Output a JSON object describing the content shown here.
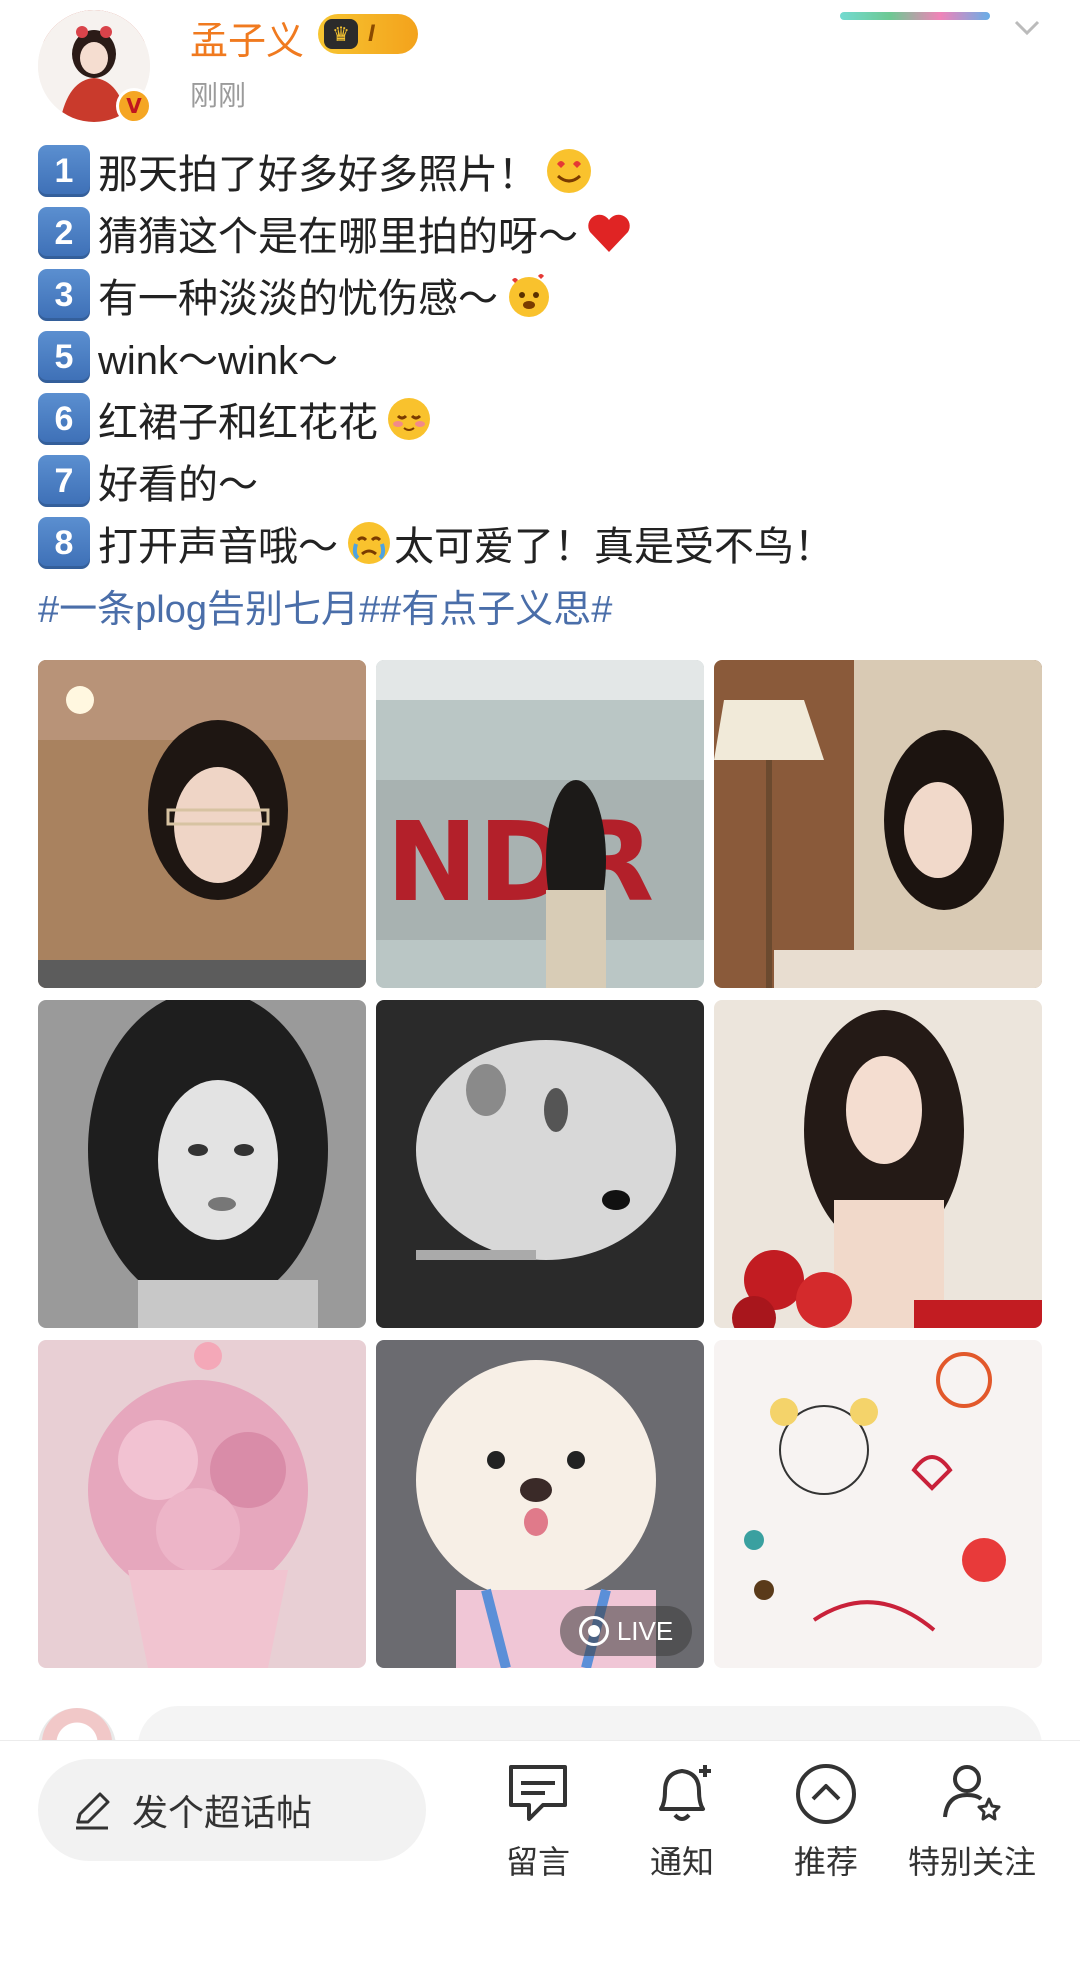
{
  "post": {
    "username": "孟子义",
    "vip_level": "I",
    "timestamp": "刚刚",
    "lines": [
      {
        "key": "1",
        "text": "那天拍了好多好多照片！",
        "emoji": "smiling-face-with-hearts"
      },
      {
        "key": "2",
        "text": "猜猜这个是在哪里拍的呀～",
        "emoji": "red-heart"
      },
      {
        "key": "3",
        "text": "有一种淡淡的忧伤感～",
        "emoji": "smiling-face-with-hearts"
      },
      {
        "key": "5",
        "text": "wink～wink～",
        "emoji": ""
      },
      {
        "key": "6",
        "text": "红裙子和红花花",
        "emoji": "blushing-face"
      },
      {
        "key": "7",
        "text": "好看的～",
        "emoji": ""
      },
      {
        "key": "8",
        "text": "打开声音哦～",
        "emoji": "crying-face",
        "tail": "太可爱了！真是受不鸟！"
      }
    ],
    "hashtags": "#一条plog告别七月##有点子义思#",
    "photos": [
      {
        "name": "photo-glasses-portrait"
      },
      {
        "name": "photo-red-letters-wall"
      },
      {
        "name": "photo-lamp-portrait"
      },
      {
        "name": "photo-bw-portrait"
      },
      {
        "name": "photo-bw-closeup"
      },
      {
        "name": "photo-roses-portrait"
      },
      {
        "name": "photo-pink-hydrangea"
      },
      {
        "name": "photo-white-puppy",
        "badge": "LIVE"
      },
      {
        "name": "photo-child-drawing"
      }
    ]
  },
  "bottom_bar": {
    "compose_label": "发个超话帖",
    "nav": [
      {
        "label": "留言",
        "icon": "message-icon"
      },
      {
        "label": "通知",
        "icon": "bell-icon"
      },
      {
        "label": "推荐",
        "icon": "chevron-up-circle-icon"
      },
      {
        "label": "特别关注",
        "icon": "user-star-icon"
      }
    ]
  },
  "colors": {
    "username": "#f07a1f",
    "hashtag": "#4a6ea9",
    "timestamp": "#9b9b9b"
  }
}
